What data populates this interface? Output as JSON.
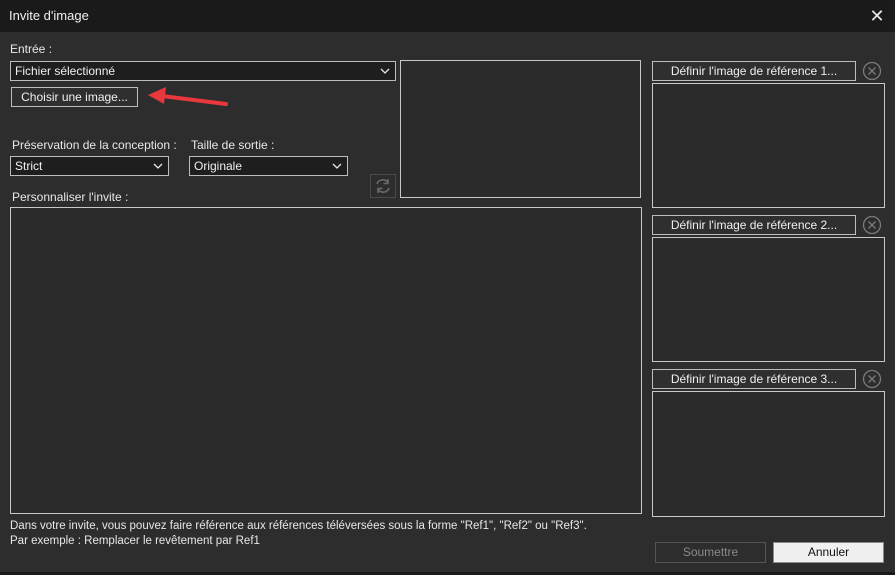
{
  "window": {
    "title": "Invite d'image",
    "close_icon": "close-icon"
  },
  "input": {
    "label": "Entrée :",
    "source_value": "Fichier sélectionné",
    "choose_button": "Choisir une image..."
  },
  "design": {
    "label": "Préservation de la conception :",
    "value": "Strict"
  },
  "output": {
    "label": "Taille de sortie :",
    "value": "Originale"
  },
  "prompt": {
    "label": "Personnaliser l'invite :",
    "value": ""
  },
  "references": [
    {
      "button": "Définir l'image de référence 1..."
    },
    {
      "button": "Définir l'image de référence 2..."
    },
    {
      "button": "Définir l'image de référence 3..."
    }
  ],
  "hints": {
    "line1": "Dans votre invite, vous pouvez faire référence aux références téléversées sous la forme \"Ref1\", \"Ref2\" ou \"Ref3\".",
    "line2": "Par exemple : Remplacer le revêtement par Ref1"
  },
  "actions": {
    "submit": "Soumettre",
    "cancel": "Annuler"
  },
  "annotation": {
    "color": "#e8383d"
  }
}
